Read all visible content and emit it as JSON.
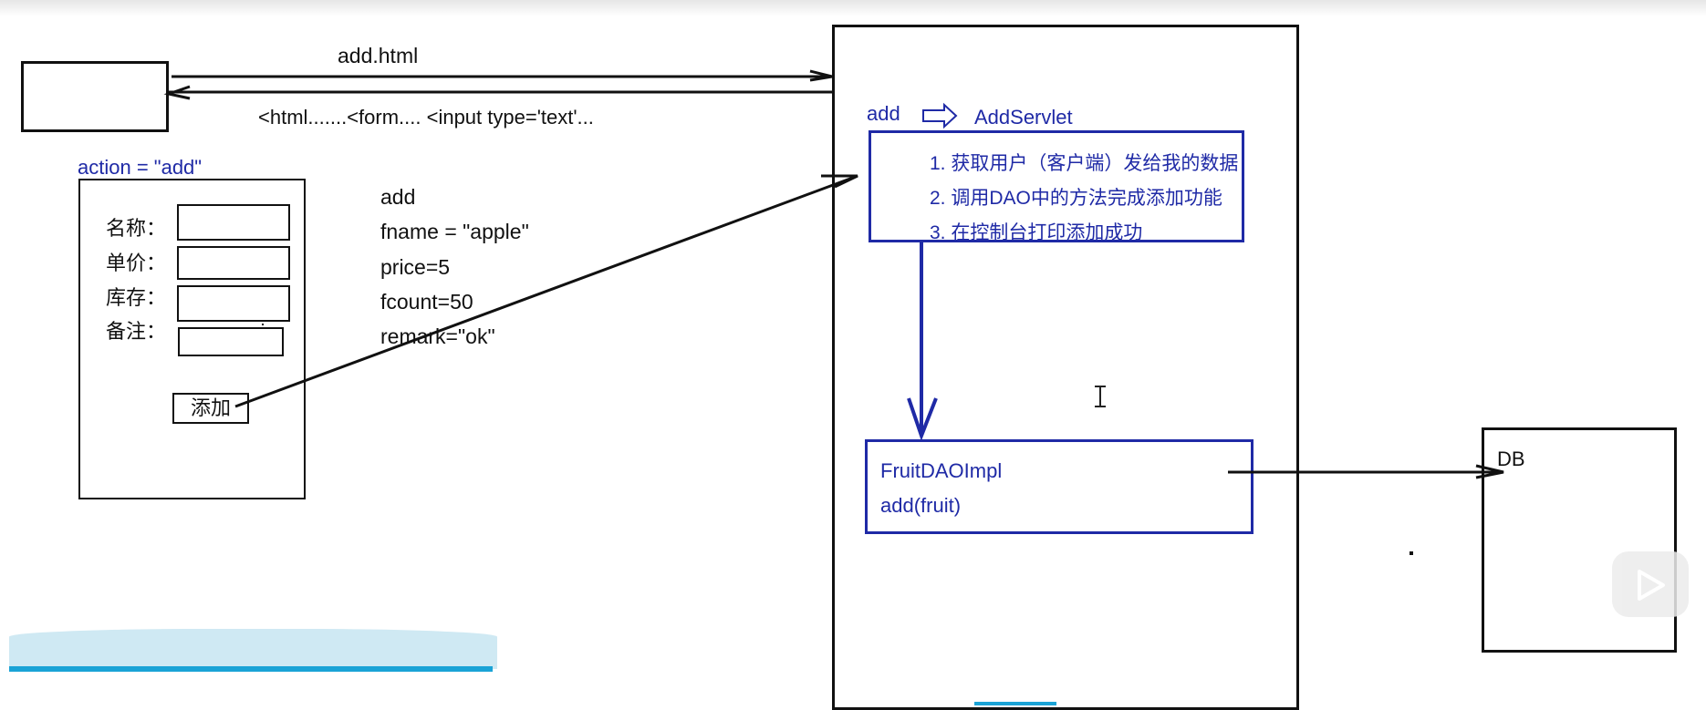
{
  "client": {
    "request_label": "add.html",
    "response_label": "<html.......<form.... <input type='text'...",
    "form_action": "action = \"add\"",
    "fields": [
      "名称：",
      "单价：",
      "库存：",
      "备注："
    ],
    "submit_button": "添加"
  },
  "params": {
    "lines": [
      "add",
      "fname = \"apple\"",
      "price=5",
      "fcount=50",
      "remark=\"ok\""
    ]
  },
  "server": {
    "mapping_key": "add",
    "servlet_name": "AddServlet",
    "steps": [
      "1. 获取用户（客户端）发给我的数据",
      "2. 调用DAO中的方法完成添加功能",
      "3. 在控制台打印添加成功"
    ],
    "dao_class": "FruitDAOImpl",
    "dao_method": "add(fruit)"
  },
  "db": {
    "label": "DB"
  },
  "colors": {
    "ink": "#111111",
    "accent": "#1f2aa6",
    "player": "#1aa3d6"
  }
}
